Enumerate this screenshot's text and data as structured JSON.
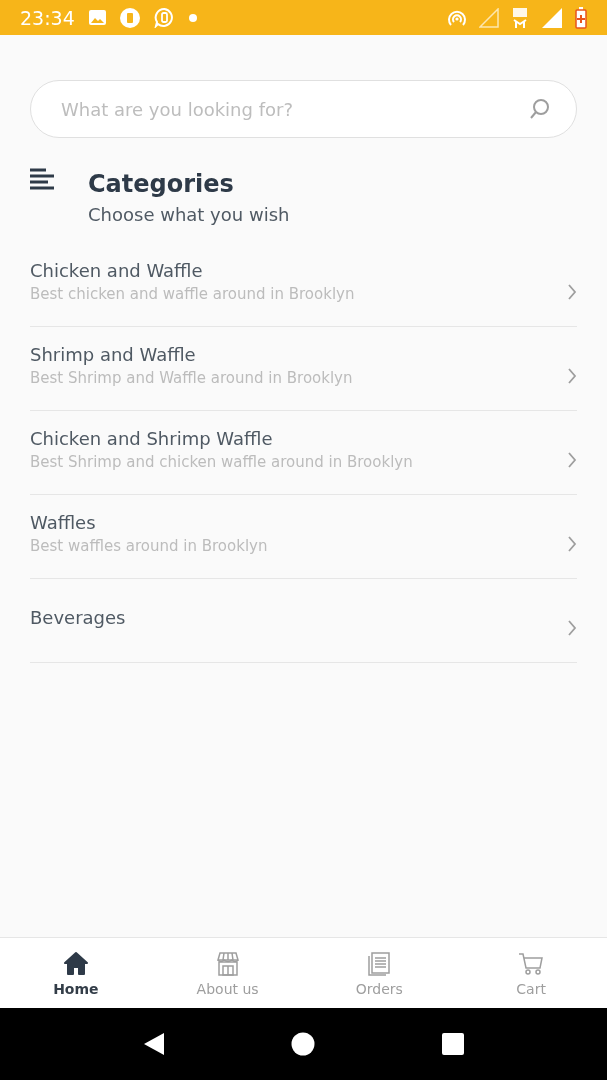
{
  "status_bar": {
    "time": "23:34"
  },
  "search": {
    "placeholder": "What are you looking for?"
  },
  "header": {
    "title": "Categories",
    "subtitle": "Choose what you wish"
  },
  "categories": [
    {
      "name": "Chicken and Waffle",
      "description": "Best chicken and waffle around in Brooklyn"
    },
    {
      "name": "Shrimp and Waffle",
      "description": "Best Shrimp and Waffle around in Brooklyn"
    },
    {
      "name": "Chicken and Shrimp Waffle",
      "description": "Best Shrimp and chicken waffle around in Brooklyn"
    },
    {
      "name": "Waffles",
      "description": "Best waffles around in Brooklyn"
    },
    {
      "name": "Beverages"
    }
  ],
  "bottom_nav": [
    {
      "label": "Home",
      "selected": true
    },
    {
      "label": "About us",
      "selected": false
    },
    {
      "label": "Orders",
      "selected": false
    },
    {
      "label": "Cart",
      "selected": false
    }
  ]
}
